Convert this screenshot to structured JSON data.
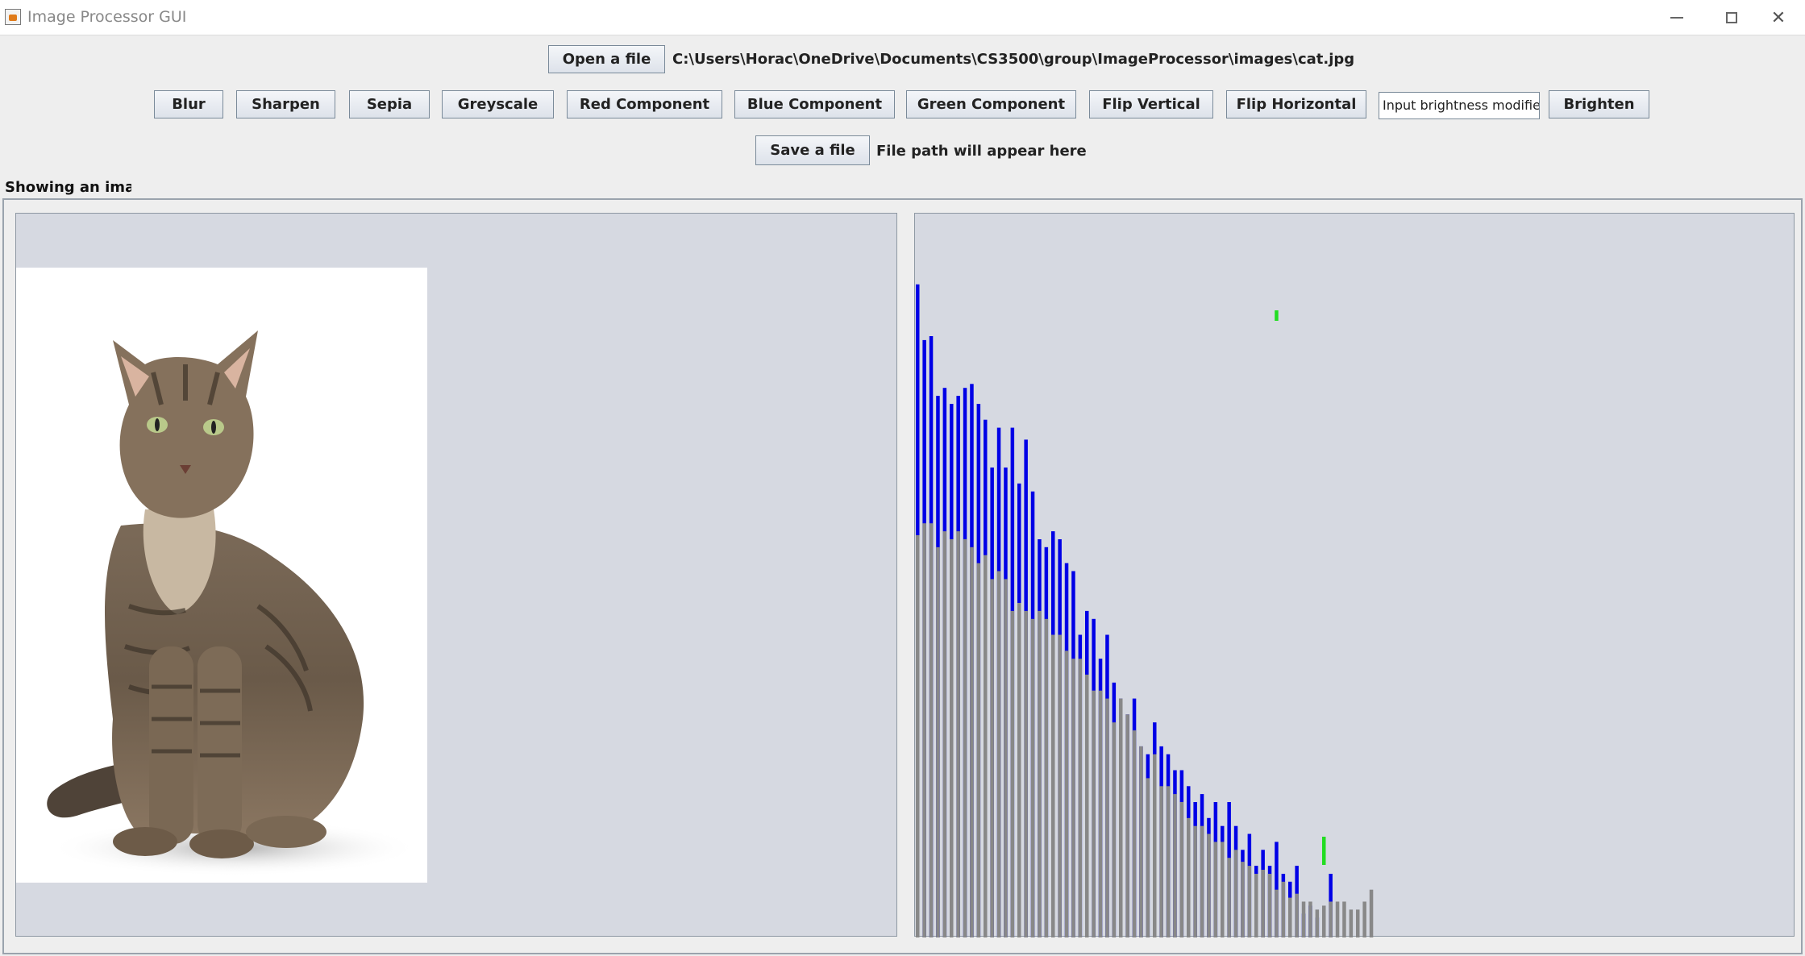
{
  "window": {
    "title": "Image Processor GUI",
    "controls": [
      "minimize",
      "maximize",
      "close"
    ]
  },
  "file": {
    "open_label": "Open a file",
    "path": "C:\\Users\\Horac\\OneDrive\\Documents\\CS3500\\group\\ImageProcessor\\images\\cat.jpg"
  },
  "toolbar": {
    "buttons": [
      "Blur",
      "Sharpen",
      "Sepia",
      "Greyscale",
      "Red Component",
      "Blue Component",
      "Green Component",
      "Flip Vertical",
      "Flip Horizontal"
    ],
    "brightness_input": "Input brightness modifier",
    "brighten_label": "Brighten"
  },
  "save": {
    "save_label": "Save a file",
    "path_text": "File path will appear here"
  },
  "status": {
    "text": "Showing an image"
  },
  "colors": {
    "blue": "#0000e6",
    "gray": "#888888",
    "green": "#22dd22",
    "panel": "#d6d9e1"
  },
  "chart_data": {
    "type": "bar",
    "title": "",
    "xlabel": "",
    "ylabel": "",
    "note_series_order": "stacked draw: blue behind, gray in front, green on top where visible",
    "series": [
      {
        "color": "blue",
        "values": [
          820,
          750,
          755,
          680,
          690,
          670,
          680,
          690,
          695,
          670,
          650,
          590,
          640,
          590,
          640,
          570,
          625,
          560,
          500,
          490,
          510,
          500,
          470,
          460,
          380,
          410,
          400,
          350,
          380,
          320,
          300,
          280,
          300,
          240,
          230,
          270,
          240,
          230,
          210,
          210,
          190,
          170,
          180,
          150,
          170,
          140,
          170,
          140,
          110,
          130,
          90,
          110,
          90,
          120,
          80,
          70,
          90,
          30,
          40,
          25,
          25,
          80
        ]
      },
      {
        "color": "gray",
        "values": [
          505,
          520,
          520,
          490,
          510,
          500,
          510,
          500,
          490,
          470,
          480,
          450,
          460,
          450,
          410,
          420,
          410,
          400,
          410,
          400,
          380,
          380,
          360,
          350,
          350,
          330,
          310,
          310,
          300,
          270,
          300,
          280,
          260,
          240,
          200,
          230,
          190,
          190,
          180,
          170,
          150,
          140,
          140,
          130,
          120,
          120,
          100,
          110,
          95,
          90,
          80,
          85,
          80,
          60,
          70,
          50,
          55,
          45,
          45,
          35,
          40,
          45,
          45,
          45,
          35,
          35,
          45,
          60
        ]
      },
      {
        "color": "green",
        "values": [
          0,
          0,
          0,
          0,
          0,
          0,
          0,
          0,
          0,
          0,
          0,
          0,
          0,
          0,
          0,
          0,
          0,
          0,
          0,
          0,
          0,
          0,
          0,
          0,
          0,
          0,
          0,
          0,
          0,
          0,
          0,
          0,
          0,
          0,
          0,
          0,
          0,
          0,
          0,
          0,
          0,
          0,
          0,
          0,
          0,
          0,
          0,
          0,
          0,
          0,
          0,
          0,
          0,
          0,
          0,
          0,
          0,
          0,
          0,
          0,
          0,
          0,
          0,
          0,
          0,
          0,
          0,
          0,
          0,
          0,
          0,
          0,
          0,
          0,
          0,
          0,
          0,
          0,
          0,
          0,
          0,
          0,
          0,
          0,
          0,
          0,
          0,
          0,
          0,
          0,
          0,
          0,
          0,
          0,
          0,
          0,
          0,
          0,
          0,
          0,
          0,
          0,
          0,
          0,
          0,
          0,
          0,
          0,
          0,
          0,
          0,
          0,
          0,
          0,
          0,
          0,
          0,
          0,
          0,
          0,
          0,
          0,
          0,
          0,
          0,
          0,
          0,
          0,
          0,
          0,
          0,
          0,
          0,
          0,
          0,
          0,
          0,
          0,
          0,
          0,
          0,
          0,
          0,
          0,
          0,
          0,
          0,
          0,
          0,
          0,
          0,
          0,
          0,
          0,
          0,
          0,
          0,
          0,
          0,
          0,
          0,
          0,
          0,
          0,
          0,
          0,
          0,
          0,
          0,
          0,
          0,
          0,
          0,
          0,
          0,
          0,
          0,
          0,
          0,
          0,
          0,
          0,
          0,
          0,
          0,
          0,
          0,
          0,
          0,
          0,
          0,
          0,
          0,
          0,
          0,
          0,
          0,
          0,
          0,
          0,
          0,
          0,
          0,
          0,
          0,
          0,
          0,
          0,
          0,
          0,
          0,
          0,
          0,
          0,
          0,
          0,
          0,
          0,
          0,
          0,
          0,
          0,
          0,
          0,
          0,
          0,
          0,
          0,
          0,
          0,
          0,
          0,
          0,
          0,
          0,
          0,
          0,
          0,
          0,
          0,
          0,
          0,
          0,
          0,
          0,
          0,
          0,
          0,
          0,
          0,
          0,
          0,
          0,
          0,
          0,
          0,
          0,
          0,
          0,
          0,
          0,
          0,
          0
        ]
      }
    ]
  }
}
